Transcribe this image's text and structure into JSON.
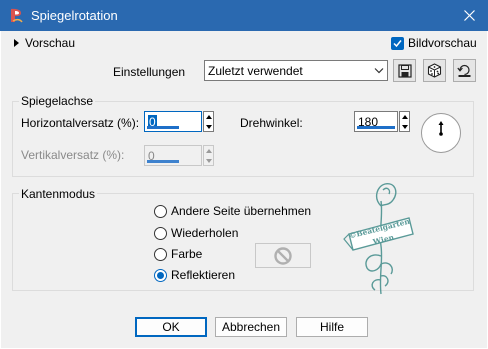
{
  "window": {
    "title": "Spiegelrotation",
    "app_icon": "psp-logo-icon",
    "close_icon": "close-icon"
  },
  "toolbar": {
    "preview_label": "Vorschau",
    "live_preview_label": "Bildvorschau",
    "live_preview_checked": true,
    "settings_label": "Einstellungen",
    "settings_value": "Zuletzt verwendet",
    "buttons": [
      "save-preset-icon",
      "randomize-icon",
      "reset-icon"
    ]
  },
  "mirror_axis": {
    "group_title": "Spiegelachse",
    "horizontal_offset_label": "Horizontalversatz (%):",
    "horizontal_offset_value": "0",
    "vertical_offset_label": "Vertikalversatz (%):",
    "vertical_offset_value": "0",
    "vertical_offset_enabled": false,
    "rotation_label": "Drehwinkel:",
    "rotation_value": "180"
  },
  "edge_mode": {
    "group_title": "Kantenmodus",
    "options": [
      {
        "label": "Andere Seite übernehmen",
        "checked": false
      },
      {
        "label": "Wiederholen",
        "checked": false
      },
      {
        "label": "Farbe",
        "checked": false
      },
      {
        "label": "Reflektieren",
        "checked": true
      }
    ],
    "color_swatch_icon": "no-symbol-icon"
  },
  "watermark": {
    "line1": "©Beatelgarten",
    "line2": "Wien"
  },
  "footer": {
    "ok_label": "OK",
    "cancel_label": "Abbrechen",
    "help_label": "Hilfe"
  },
  "colors": {
    "titlebar": "#2a69b0",
    "accent": "#0067c0",
    "dialog_bg": "#f0f0f0",
    "watermark": "#5a9a98"
  }
}
